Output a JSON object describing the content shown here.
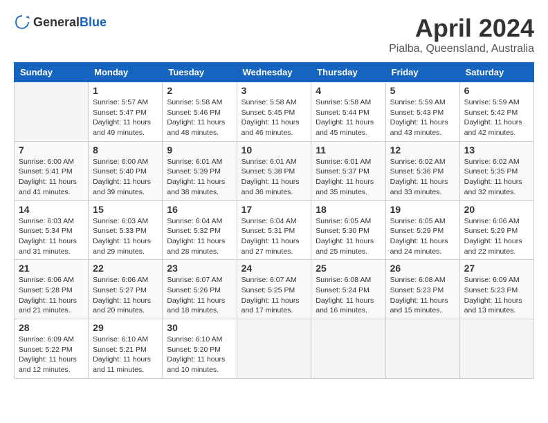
{
  "logo": {
    "text_general": "General",
    "text_blue": "Blue"
  },
  "title": "April 2024",
  "location": "Pialba, Queensland, Australia",
  "days_of_week": [
    "Sunday",
    "Monday",
    "Tuesday",
    "Wednesday",
    "Thursday",
    "Friday",
    "Saturday"
  ],
  "weeks": [
    [
      {
        "day": "",
        "info": ""
      },
      {
        "day": "1",
        "info": "Sunrise: 5:57 AM\nSunset: 5:47 PM\nDaylight: 11 hours\nand 49 minutes."
      },
      {
        "day": "2",
        "info": "Sunrise: 5:58 AM\nSunset: 5:46 PM\nDaylight: 11 hours\nand 48 minutes."
      },
      {
        "day": "3",
        "info": "Sunrise: 5:58 AM\nSunset: 5:45 PM\nDaylight: 11 hours\nand 46 minutes."
      },
      {
        "day": "4",
        "info": "Sunrise: 5:58 AM\nSunset: 5:44 PM\nDaylight: 11 hours\nand 45 minutes."
      },
      {
        "day": "5",
        "info": "Sunrise: 5:59 AM\nSunset: 5:43 PM\nDaylight: 11 hours\nand 43 minutes."
      },
      {
        "day": "6",
        "info": "Sunrise: 5:59 AM\nSunset: 5:42 PM\nDaylight: 11 hours\nand 42 minutes."
      }
    ],
    [
      {
        "day": "7",
        "info": "Sunrise: 6:00 AM\nSunset: 5:41 PM\nDaylight: 11 hours\nand 41 minutes."
      },
      {
        "day": "8",
        "info": "Sunrise: 6:00 AM\nSunset: 5:40 PM\nDaylight: 11 hours\nand 39 minutes."
      },
      {
        "day": "9",
        "info": "Sunrise: 6:01 AM\nSunset: 5:39 PM\nDaylight: 11 hours\nand 38 minutes."
      },
      {
        "day": "10",
        "info": "Sunrise: 6:01 AM\nSunset: 5:38 PM\nDaylight: 11 hours\nand 36 minutes."
      },
      {
        "day": "11",
        "info": "Sunrise: 6:01 AM\nSunset: 5:37 PM\nDaylight: 11 hours\nand 35 minutes."
      },
      {
        "day": "12",
        "info": "Sunrise: 6:02 AM\nSunset: 5:36 PM\nDaylight: 11 hours\nand 33 minutes."
      },
      {
        "day": "13",
        "info": "Sunrise: 6:02 AM\nSunset: 5:35 PM\nDaylight: 11 hours\nand 32 minutes."
      }
    ],
    [
      {
        "day": "14",
        "info": "Sunrise: 6:03 AM\nSunset: 5:34 PM\nDaylight: 11 hours\nand 31 minutes."
      },
      {
        "day": "15",
        "info": "Sunrise: 6:03 AM\nSunset: 5:33 PM\nDaylight: 11 hours\nand 29 minutes."
      },
      {
        "day": "16",
        "info": "Sunrise: 6:04 AM\nSunset: 5:32 PM\nDaylight: 11 hours\nand 28 minutes."
      },
      {
        "day": "17",
        "info": "Sunrise: 6:04 AM\nSunset: 5:31 PM\nDaylight: 11 hours\nand 27 minutes."
      },
      {
        "day": "18",
        "info": "Sunrise: 6:05 AM\nSunset: 5:30 PM\nDaylight: 11 hours\nand 25 minutes."
      },
      {
        "day": "19",
        "info": "Sunrise: 6:05 AM\nSunset: 5:29 PM\nDaylight: 11 hours\nand 24 minutes."
      },
      {
        "day": "20",
        "info": "Sunrise: 6:06 AM\nSunset: 5:29 PM\nDaylight: 11 hours\nand 22 minutes."
      }
    ],
    [
      {
        "day": "21",
        "info": "Sunrise: 6:06 AM\nSunset: 5:28 PM\nDaylight: 11 hours\nand 21 minutes."
      },
      {
        "day": "22",
        "info": "Sunrise: 6:06 AM\nSunset: 5:27 PM\nDaylight: 11 hours\nand 20 minutes."
      },
      {
        "day": "23",
        "info": "Sunrise: 6:07 AM\nSunset: 5:26 PM\nDaylight: 11 hours\nand 18 minutes."
      },
      {
        "day": "24",
        "info": "Sunrise: 6:07 AM\nSunset: 5:25 PM\nDaylight: 11 hours\nand 17 minutes."
      },
      {
        "day": "25",
        "info": "Sunrise: 6:08 AM\nSunset: 5:24 PM\nDaylight: 11 hours\nand 16 minutes."
      },
      {
        "day": "26",
        "info": "Sunrise: 6:08 AM\nSunset: 5:23 PM\nDaylight: 11 hours\nand 15 minutes."
      },
      {
        "day": "27",
        "info": "Sunrise: 6:09 AM\nSunset: 5:23 PM\nDaylight: 11 hours\nand 13 minutes."
      }
    ],
    [
      {
        "day": "28",
        "info": "Sunrise: 6:09 AM\nSunset: 5:22 PM\nDaylight: 11 hours\nand 12 minutes."
      },
      {
        "day": "29",
        "info": "Sunrise: 6:10 AM\nSunset: 5:21 PM\nDaylight: 11 hours\nand 11 minutes."
      },
      {
        "day": "30",
        "info": "Sunrise: 6:10 AM\nSunset: 5:20 PM\nDaylight: 11 hours\nand 10 minutes."
      },
      {
        "day": "",
        "info": ""
      },
      {
        "day": "",
        "info": ""
      },
      {
        "day": "",
        "info": ""
      },
      {
        "day": "",
        "info": ""
      }
    ]
  ]
}
